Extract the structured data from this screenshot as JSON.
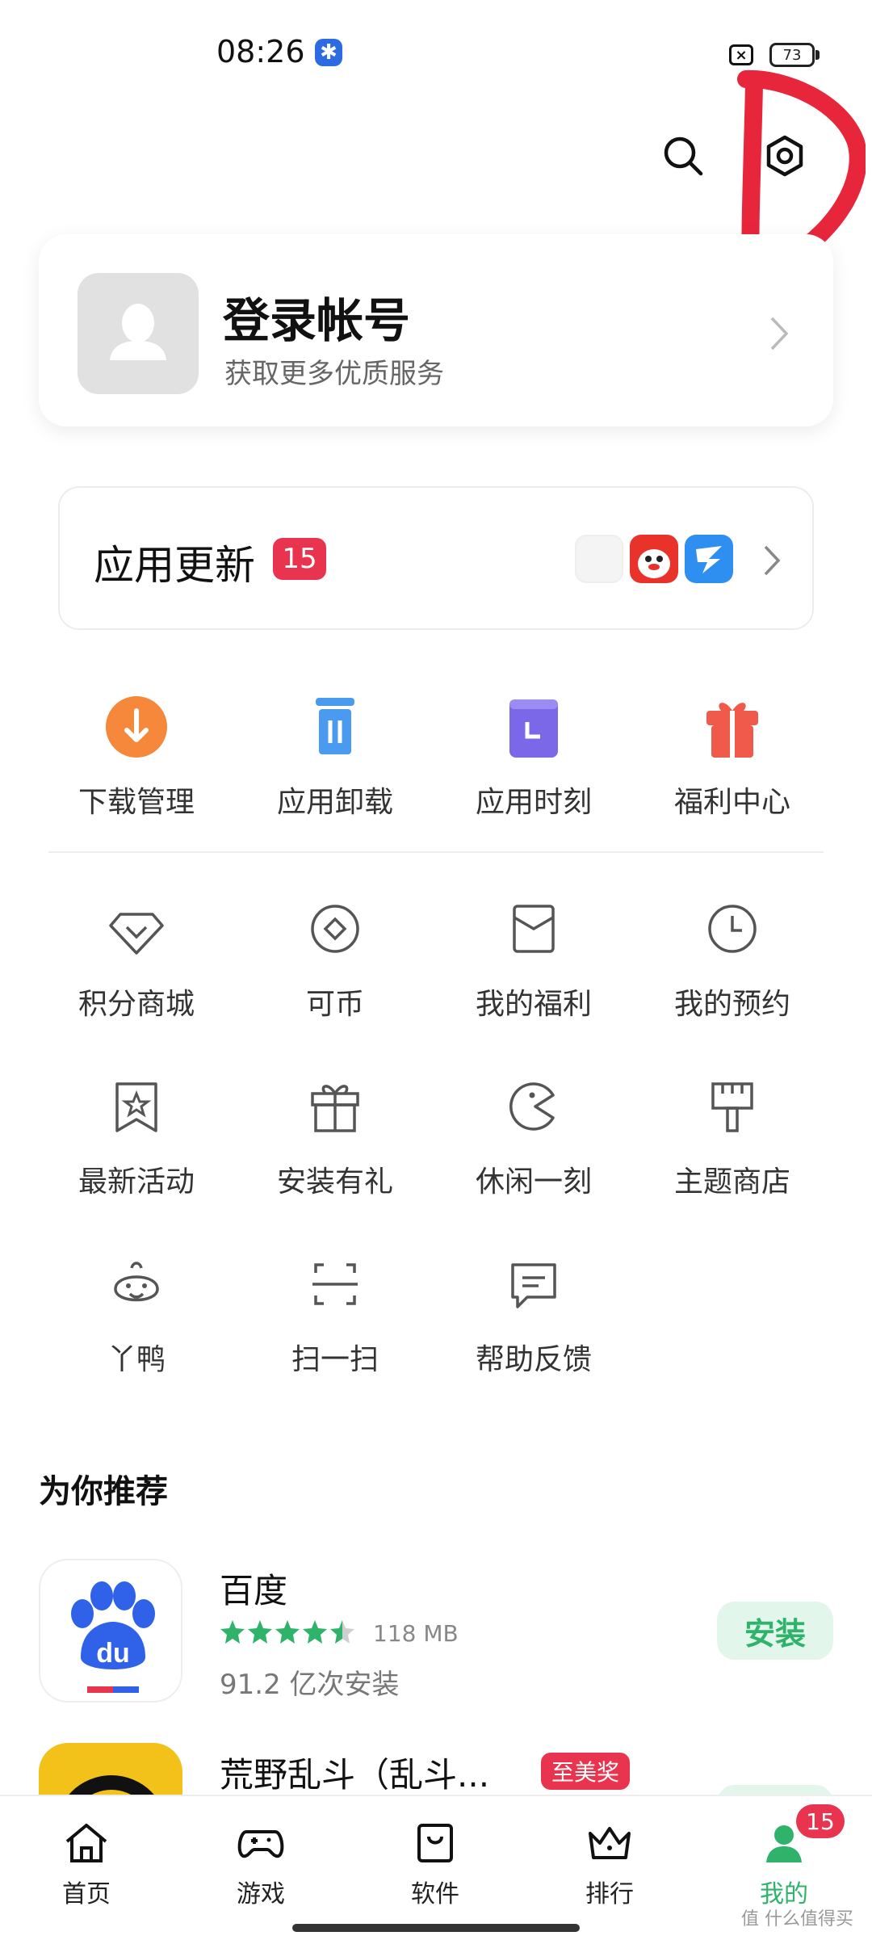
{
  "status_bar": {
    "time": "08:26",
    "battery": "73"
  },
  "header": {
    "search_icon": "search-icon",
    "settings_icon": "gear-icon"
  },
  "login": {
    "title": "登录帐号",
    "subtitle": "获取更多优质服务"
  },
  "updates": {
    "label": "应用更新",
    "count": "15"
  },
  "primary_grid": [
    {
      "label": "下载管理",
      "icon": "download-icon",
      "color": "#f5883a"
    },
    {
      "label": "应用卸载",
      "icon": "trash-icon",
      "color": "#4a9bf0"
    },
    {
      "label": "应用时刻",
      "icon": "calendar-icon",
      "color": "#7b68e8"
    },
    {
      "label": "福利中心",
      "icon": "gift-icon",
      "color": "#f05a4a"
    }
  ],
  "secondary_grid": [
    {
      "label": "积分商城",
      "icon": "diamond-icon"
    },
    {
      "label": "可币",
      "icon": "coin-icon"
    },
    {
      "label": "我的福利",
      "icon": "envelope-icon"
    },
    {
      "label": "我的预约",
      "icon": "clock-icon"
    },
    {
      "label": "最新活动",
      "icon": "bookmark-star-icon"
    },
    {
      "label": "安装有礼",
      "icon": "giftbox-icon"
    },
    {
      "label": "休闲一刻",
      "icon": "pacman-icon"
    },
    {
      "label": "主题商店",
      "icon": "brush-icon"
    },
    {
      "label": "丫鸭",
      "icon": "duck-icon"
    },
    {
      "label": "扫一扫",
      "icon": "scan-icon"
    },
    {
      "label": "帮助反馈",
      "icon": "feedback-icon"
    }
  ],
  "recommend": {
    "title": "为你推荐",
    "apps": [
      {
        "name": "百度",
        "size": "118 MB",
        "installs": "91.2 亿次安装",
        "action": "安装",
        "rating": 4.5
      },
      {
        "name": "荒野乱斗（乱斗...",
        "award": "至美奖"
      }
    ]
  },
  "bottom_nav": [
    {
      "label": "首页",
      "icon": "home-icon"
    },
    {
      "label": "游戏",
      "icon": "gamepad-icon"
    },
    {
      "label": "软件",
      "icon": "bag-icon"
    },
    {
      "label": "排行",
      "icon": "crown-icon"
    },
    {
      "label": "我的",
      "icon": "person-icon",
      "badge": "15"
    }
  ],
  "colors": {
    "accent_green": "#2fb36b",
    "badge_red": "#e8344e"
  },
  "watermark": "值 什么值得买"
}
